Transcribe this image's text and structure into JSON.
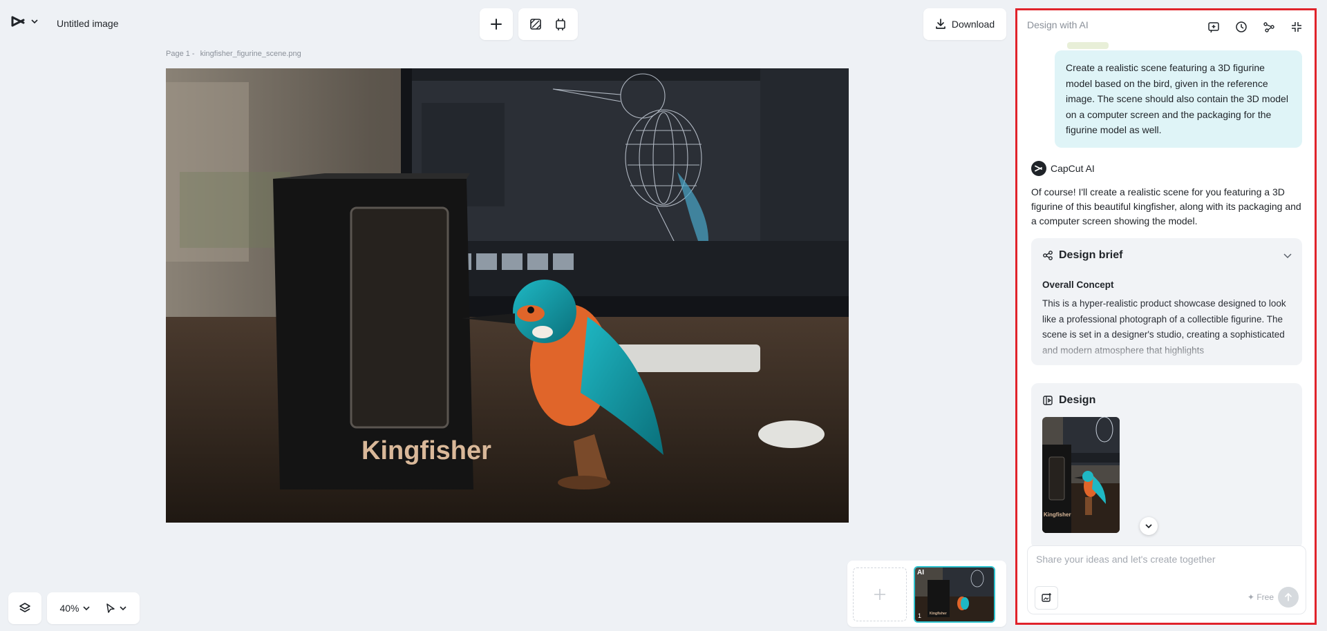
{
  "app": {
    "title": "Untitled image",
    "logo_icon": "capcut-logo-icon"
  },
  "toolbar": {
    "add_icon": "plus-icon",
    "remove_bg_icon": "slash-square-icon",
    "resize_icon": "crop-resize-icon",
    "download_label": "Download"
  },
  "canvas": {
    "page_prefix": "Page 1 -",
    "filename": "kingfisher_figurine_scene.png",
    "box_label": "Kingfisher"
  },
  "bottom": {
    "zoom_label": "40%",
    "layers_icon": "layers-icon",
    "pointer_icon": "pointer-icon"
  },
  "thumbnails": {
    "badge": "AI",
    "page_number": "1",
    "thumb_box_label": "Kingfisher"
  },
  "panel": {
    "title": "Design with AI",
    "icons": [
      "new-chat-icon",
      "history-icon",
      "share-icon",
      "collapse-icon"
    ],
    "user_message": "Create a realistic scene featuring a 3D figurine model based on the bird, given in the reference image. The scene should also contain the 3D model on a computer screen and the packaging for the figurine model as well.",
    "ai_name": "CapCut AI",
    "ai_message": "Of course! I'll create a realistic scene for you featuring a 3D figurine of this beautiful kingfisher, along with its packaging and a computer screen showing the model.",
    "brief": {
      "title": "Design brief",
      "section_title": "Overall Concept",
      "text": "This is a hyper-realistic product showcase designed to look like a professional photograph of a collectible figurine. The scene is set in a designer's studio, creating a sophisticated and modern atmosphere that highlights"
    },
    "design": {
      "title": "Design",
      "thumb_label": "Kingfisher"
    },
    "composer": {
      "placeholder": "Share your ideas and let's create together",
      "free_label": "Free"
    }
  },
  "colors": {
    "accent": "#2cc3cf",
    "panel_border": "#e0232b",
    "bubble": "#dff4f7",
    "background": "#eef1f5"
  }
}
